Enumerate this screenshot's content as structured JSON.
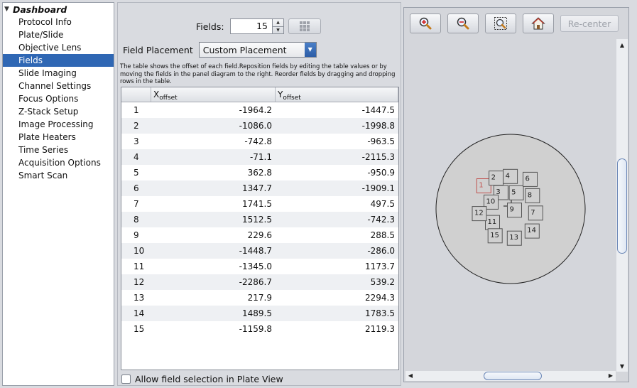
{
  "sidebar": {
    "root_label": "Dashboard",
    "items": [
      {
        "label": "Protocol Info",
        "selected": false
      },
      {
        "label": "Plate/Slide",
        "selected": false
      },
      {
        "label": "Objective Lens",
        "selected": false
      },
      {
        "label": "Fields",
        "selected": true
      },
      {
        "label": "Slide Imaging",
        "selected": false
      },
      {
        "label": "Channel Settings",
        "selected": false
      },
      {
        "label": "Focus Options",
        "selected": false
      },
      {
        "label": "Z-Stack Setup",
        "selected": false
      },
      {
        "label": "Image Processing",
        "selected": false
      },
      {
        "label": "Plate Heaters",
        "selected": false
      },
      {
        "label": "Time Series",
        "selected": false
      },
      {
        "label": "Acquisition Options",
        "selected": false
      },
      {
        "label": "Smart Scan",
        "selected": false
      }
    ]
  },
  "fields_panel": {
    "fields_label": "Fields:",
    "fields_value": "15",
    "placement_label": "Field Placement",
    "placement_value": "Custom Placement",
    "description": "The table shows the offset of each field.Reposition fields by editing the table values or by moving the fields in the panel diagram to the right. Reorder fields by dragging and dropping rows in the table.",
    "table": {
      "x_header": "X",
      "x_header_sub": "offset",
      "y_header": "Y",
      "y_header_sub": "offset",
      "rows": [
        {
          "idx": "1",
          "x": "-1964.2",
          "y": "-1447.5"
        },
        {
          "idx": "2",
          "x": "-1086.0",
          "y": "-1998.8"
        },
        {
          "idx": "3",
          "x": "-742.8",
          "y": "-963.5"
        },
        {
          "idx": "4",
          "x": "-71.1",
          "y": "-2115.3"
        },
        {
          "idx": "5",
          "x": "362.8",
          "y": "-950.9"
        },
        {
          "idx": "6",
          "x": "1347.7",
          "y": "-1909.1"
        },
        {
          "idx": "7",
          "x": "1741.5",
          "y": "497.5"
        },
        {
          "idx": "8",
          "x": "1512.5",
          "y": "-742.3"
        },
        {
          "idx": "9",
          "x": "229.6",
          "y": "288.5"
        },
        {
          "idx": "10",
          "x": "-1448.7",
          "y": "-286.0"
        },
        {
          "idx": "11",
          "x": "-1345.0",
          "y": "1173.7"
        },
        {
          "idx": "12",
          "x": "-2286.7",
          "y": "539.2"
        },
        {
          "idx": "13",
          "x": "217.9",
          "y": "2294.3"
        },
        {
          "idx": "14",
          "x": "1489.5",
          "y": "1783.5"
        },
        {
          "idx": "15",
          "x": "-1159.8",
          "y": "2119.3"
        }
      ]
    },
    "allow_selection_label": "Allow field selection in Plate View",
    "allow_selection_checked": false
  },
  "plate_view": {
    "recenter_label": "Re-center",
    "tools": [
      "zoom-in-icon",
      "zoom-out-icon",
      "zoom-fit-icon",
      "home-icon"
    ],
    "selected_field": "1",
    "colors": {
      "accent": "#2f67b4",
      "selected_field": "#c0504d"
    }
  }
}
